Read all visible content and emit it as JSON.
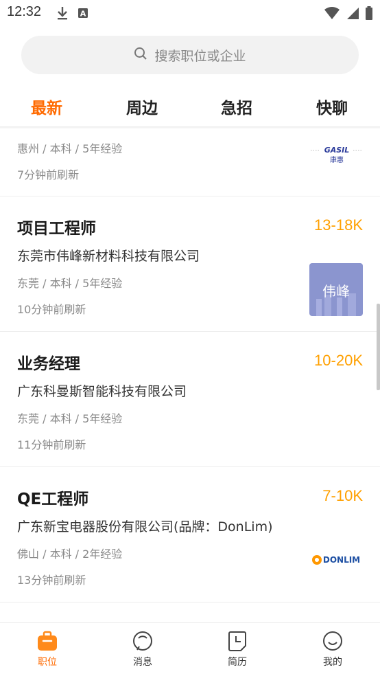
{
  "status_bar": {
    "time": "12:32"
  },
  "search": {
    "placeholder": "搜索职位或企业"
  },
  "tabs": [
    {
      "label": "最新",
      "active": true
    },
    {
      "label": "周边",
      "active": false
    },
    {
      "label": "急招",
      "active": false
    },
    {
      "label": "快聊",
      "active": false
    }
  ],
  "jobs": [
    {
      "title": "",
      "salary": "",
      "company": "",
      "requirements": "惠州 / 本科 / 5年经验",
      "refreshed": "7分钟前刷新",
      "logo": {
        "text": "康惠",
        "brand": "GASIL"
      }
    },
    {
      "title": "项目工程师",
      "salary": "13-18K",
      "company": "东莞市伟峰新材料科技有限公司",
      "requirements": "东莞 / 本科 / 5年经验",
      "refreshed": "10分钟前刷新",
      "logo": {
        "text": "伟峰"
      }
    },
    {
      "title": "业务经理",
      "salary": "10-20K",
      "company": "广东科曼斯智能科技有限公司",
      "requirements": "东莞 / 本科 / 5年经验",
      "refreshed": "11分钟前刷新"
    },
    {
      "title": "QE工程师",
      "salary": "7-10K",
      "company": "广东新宝电器股份有限公司(品牌：DonLim)",
      "requirements": "佛山 / 本科 / 2年经验",
      "refreshed": "13分钟前刷新",
      "logo": {
        "text": "DONLIM"
      }
    }
  ],
  "bottom_nav": [
    {
      "label": "职位",
      "icon": "briefcase-icon",
      "active": true
    },
    {
      "label": "消息",
      "icon": "message-icon",
      "active": false
    },
    {
      "label": "简历",
      "icon": "resume-icon",
      "active": false
    },
    {
      "label": "我的",
      "icon": "profile-icon",
      "active": false
    }
  ],
  "colors": {
    "accent": "#ff6a00",
    "salary": "#ffa000",
    "muted": "#8a8a8a"
  }
}
